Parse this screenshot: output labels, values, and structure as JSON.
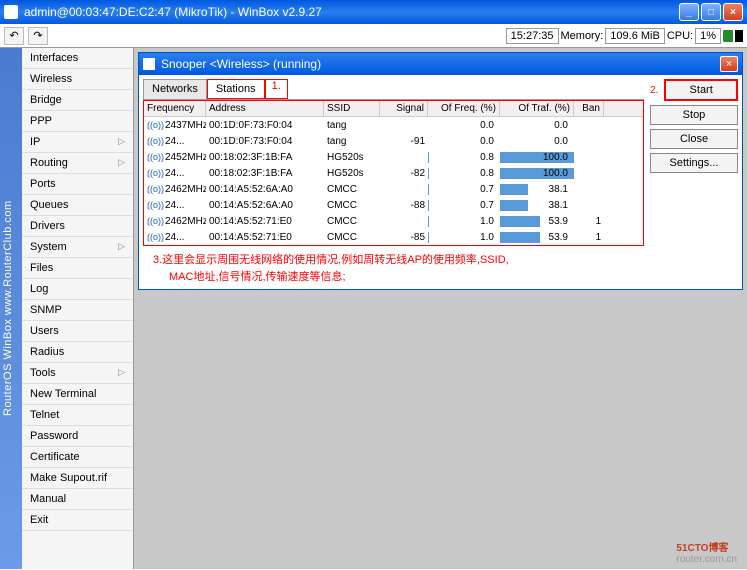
{
  "titlebar": "admin@00:03:47:DE:C2:47 (MikroTik) - WinBox v2.9.27",
  "status": {
    "time": "15:27:35",
    "mem_label": "Memory:",
    "mem": "109.6 MiB",
    "cpu_label": "CPU:",
    "cpu": "1%"
  },
  "leftstrip": "RouterOS WinBox    www.RouterClub.com",
  "sidebar": [
    {
      "label": "Interfaces",
      "sub": false
    },
    {
      "label": "Wireless",
      "sub": false
    },
    {
      "label": "Bridge",
      "sub": false
    },
    {
      "label": "PPP",
      "sub": false
    },
    {
      "label": "IP",
      "sub": true
    },
    {
      "label": "Routing",
      "sub": true
    },
    {
      "label": "Ports",
      "sub": false
    },
    {
      "label": "Queues",
      "sub": false
    },
    {
      "label": "Drivers",
      "sub": false
    },
    {
      "label": "System",
      "sub": true
    },
    {
      "label": "Files",
      "sub": false
    },
    {
      "label": "Log",
      "sub": false
    },
    {
      "label": "SNMP",
      "sub": false
    },
    {
      "label": "Users",
      "sub": false
    },
    {
      "label": "Radius",
      "sub": false
    },
    {
      "label": "Tools",
      "sub": true
    },
    {
      "label": "New Terminal",
      "sub": false
    },
    {
      "label": "Telnet",
      "sub": false
    },
    {
      "label": "Password",
      "sub": false
    },
    {
      "label": "Certificate",
      "sub": false
    },
    {
      "label": "Make Supout.rif",
      "sub": false
    },
    {
      "label": "Manual",
      "sub": false
    },
    {
      "label": "Exit",
      "sub": false
    }
  ],
  "snooper": {
    "title": "Snooper <Wireless> (running)",
    "tabs": {
      "networks": "Networks",
      "stations": "Stations",
      "annot": "1."
    },
    "headers": {
      "freq": "Frequency",
      "addr": "Address",
      "ssid": "SSID",
      "sig": "Signal",
      "of": "Of Freq. (%)",
      "tr": "Of Traf. (%)",
      "ban": "Ban"
    },
    "rows": [
      {
        "freq": "2437MHz",
        "addr": "00:1D:0F:73:F0:04",
        "ssid": "tang",
        "sig": "",
        "of": "0.0",
        "ofb": 0,
        "tr": "0.0",
        "trb": 0,
        "ban": ""
      },
      {
        "freq": "24...",
        "addr": "00:1D:0F:73:F0:04",
        "ssid": "tang",
        "sig": "-91",
        "of": "0.0",
        "ofb": 0,
        "tr": "0.0",
        "trb": 0,
        "ban": ""
      },
      {
        "freq": "2452MHz",
        "addr": "00:18:02:3F:1B:FA",
        "ssid": "HG520s",
        "sig": "",
        "of": "0.8",
        "ofb": 1,
        "tr": "100.0",
        "trb": 100,
        "ban": ""
      },
      {
        "freq": "24...",
        "addr": "00:18:02:3F:1B:FA",
        "ssid": "HG520s",
        "sig": "-82",
        "of": "0.8",
        "ofb": 1,
        "tr": "100.0",
        "trb": 100,
        "ban": ""
      },
      {
        "freq": "2462MHz",
        "addr": "00:14:A5:52:6A:A0",
        "ssid": "CMCC",
        "sig": "",
        "of": "0.7",
        "ofb": 1,
        "tr": "38.1",
        "trb": 38,
        "ban": ""
      },
      {
        "freq": "24...",
        "addr": "00:14:A5:52:6A:A0",
        "ssid": "CMCC",
        "sig": "-88",
        "of": "0.7",
        "ofb": 1,
        "tr": "38.1",
        "trb": 38,
        "ban": ""
      },
      {
        "freq": "2462MHz",
        "addr": "00:14:A5:52:71:E0",
        "ssid": "CMCC",
        "sig": "",
        "of": "1.0",
        "ofb": 1,
        "tr": "53.9",
        "trb": 54,
        "ban": "1"
      },
      {
        "freq": "24...",
        "addr": "00:14:A5:52:71:E0",
        "ssid": "CMCC",
        "sig": "-85",
        "of": "1.0",
        "ofb": 1,
        "tr": "53.9",
        "trb": 54,
        "ban": "1"
      }
    ],
    "footnote_l1": "3.这里会显示周围无线网络的使用情况,例如周转无线AP的使用频率,SSID,",
    "footnote_l2": "MAC地址,信号情况,传输速度等信息;",
    "buttons": {
      "start_annot": "2.",
      "start": "Start",
      "stop": "Stop",
      "close": "Close",
      "settings": "Settings..."
    }
  },
  "watermark": {
    "brand": "51CTO博客",
    "url": "router.com.cn"
  }
}
